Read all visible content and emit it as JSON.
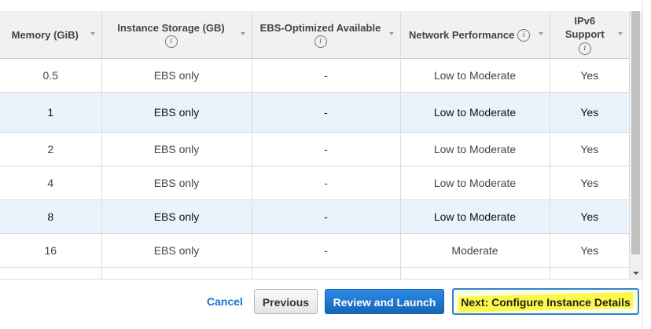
{
  "table": {
    "columns": [
      {
        "label": "Memory (GiB)",
        "info": false
      },
      {
        "label": "Instance Storage (GB)",
        "info": true
      },
      {
        "label": "EBS-Optimized Available",
        "info": true
      },
      {
        "label": "Network Performance",
        "info": true
      },
      {
        "label": "IPv6 Support",
        "info": true
      }
    ],
    "rows": [
      {
        "memory": "0.5",
        "storage": "EBS only",
        "ebs_optimized": "-",
        "network": "Low to Moderate",
        "ipv6": "Yes",
        "selected": false
      },
      {
        "memory": "1",
        "storage": "EBS only",
        "ebs_optimized": "-",
        "network": "Low to Moderate",
        "ipv6": "Yes",
        "selected": true
      },
      {
        "memory": "2",
        "storage": "EBS only",
        "ebs_optimized": "-",
        "network": "Low to Moderate",
        "ipv6": "Yes",
        "selected": false
      },
      {
        "memory": "4",
        "storage": "EBS only",
        "ebs_optimized": "-",
        "network": "Low to Moderate",
        "ipv6": "Yes",
        "selected": false
      },
      {
        "memory": "8",
        "storage": "EBS only",
        "ebs_optimized": "-",
        "network": "Low to Moderate",
        "ipv6": "Yes",
        "selected": true
      },
      {
        "memory": "16",
        "storage": "EBS only",
        "ebs_optimized": "-",
        "network": "Moderate",
        "ipv6": "Yes",
        "selected": false
      }
    ],
    "info_glyph": "i"
  },
  "footer": {
    "cancel_label": "Cancel",
    "previous_label": "Previous",
    "review_label": "Review and Launch",
    "next_label": "Next: Configure Instance Details"
  },
  "colors": {
    "selected_row": "#eaf3fc",
    "primary_button": "#1f76c9",
    "link": "#1a73d6",
    "highlight": "#fbf84a"
  },
  "icons": [
    "info-icon",
    "sort-caret-icon",
    "scroll-down-arrow-icon"
  ]
}
